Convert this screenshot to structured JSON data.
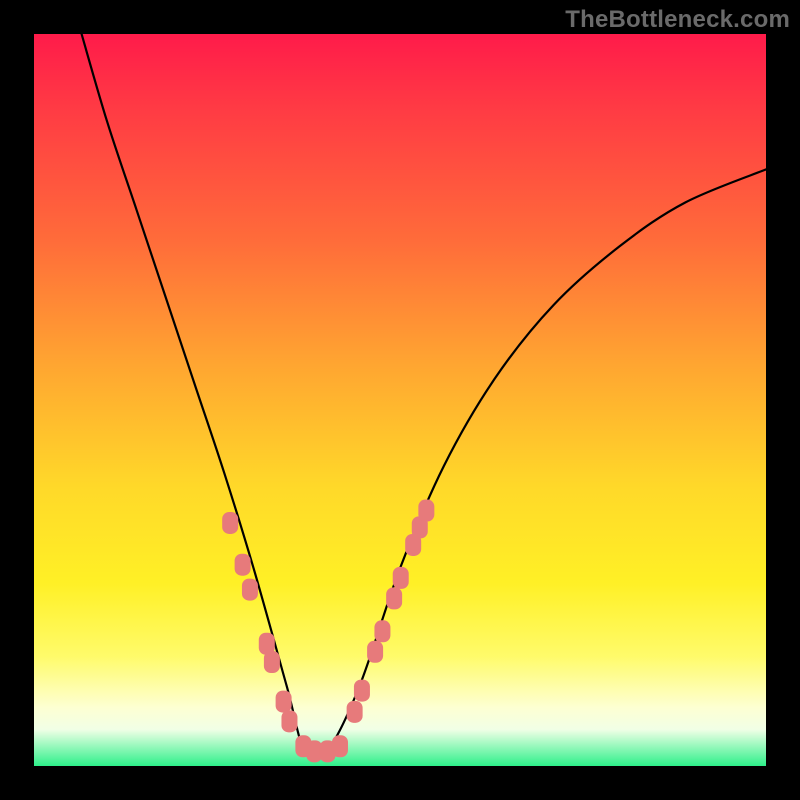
{
  "attribution": "TheBottleneck.com",
  "chart_data": {
    "type": "line",
    "title": "",
    "xlabel": "",
    "ylabel": "",
    "xlim": [
      0,
      1
    ],
    "ylim": [
      0,
      1
    ],
    "note": "Axes are unlabeled in the image; values are normalized 0–1 based on the plotting area.",
    "series": [
      {
        "name": "bottleneck-curve",
        "x": [
          0.065,
          0.1,
          0.14,
          0.18,
          0.22,
          0.26,
          0.3,
          0.345,
          0.37,
          0.4,
          0.445,
          0.5,
          0.56,
          0.63,
          0.71,
          0.8,
          0.89,
          1.0
        ],
        "y": [
          1.0,
          0.88,
          0.76,
          0.64,
          0.52,
          0.4,
          0.27,
          0.11,
          0.02,
          0.02,
          0.11,
          0.27,
          0.41,
          0.53,
          0.63,
          0.71,
          0.77,
          0.815
        ]
      }
    ],
    "markers": {
      "name": "highlighted-band",
      "points": [
        {
          "x": 0.268,
          "y": 0.332
        },
        {
          "x": 0.285,
          "y": 0.275
        },
        {
          "x": 0.295,
          "y": 0.241
        },
        {
          "x": 0.318,
          "y": 0.167
        },
        {
          "x": 0.325,
          "y": 0.142
        },
        {
          "x": 0.341,
          "y": 0.088
        },
        {
          "x": 0.349,
          "y": 0.061
        },
        {
          "x": 0.368,
          "y": 0.027
        },
        {
          "x": 0.383,
          "y": 0.02
        },
        {
          "x": 0.401,
          "y": 0.02
        },
        {
          "x": 0.418,
          "y": 0.027
        },
        {
          "x": 0.438,
          "y": 0.074
        },
        {
          "x": 0.448,
          "y": 0.103
        },
        {
          "x": 0.466,
          "y": 0.156
        },
        {
          "x": 0.476,
          "y": 0.184
        },
        {
          "x": 0.492,
          "y": 0.229
        },
        {
          "x": 0.501,
          "y": 0.257
        },
        {
          "x": 0.518,
          "y": 0.302
        },
        {
          "x": 0.527,
          "y": 0.326
        },
        {
          "x": 0.536,
          "y": 0.349
        }
      ]
    },
    "gradient_stops": [
      {
        "pos": 0.0,
        "color": "#ff1b4a"
      },
      {
        "pos": 0.1,
        "color": "#ff3a44"
      },
      {
        "pos": 0.28,
        "color": "#ff6b3a"
      },
      {
        "pos": 0.45,
        "color": "#ffa531"
      },
      {
        "pos": 0.62,
        "color": "#ffd929"
      },
      {
        "pos": 0.75,
        "color": "#fff026"
      },
      {
        "pos": 0.85,
        "color": "#fffb6a"
      },
      {
        "pos": 0.92,
        "color": "#fdffd2"
      },
      {
        "pos": 0.95,
        "color": "#f1ffe6"
      },
      {
        "pos": 1.0,
        "color": "#2ef08a"
      }
    ]
  }
}
